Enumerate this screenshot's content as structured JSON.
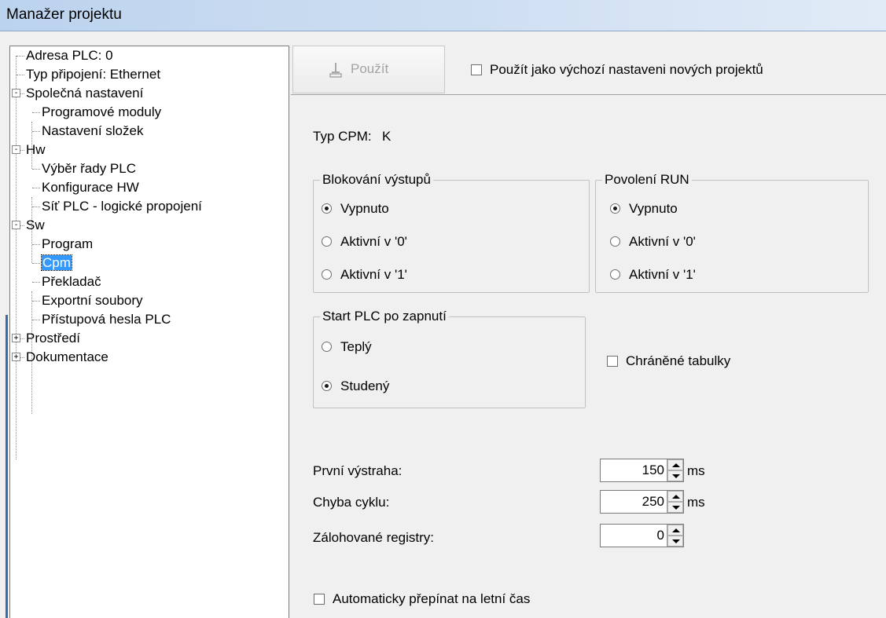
{
  "window": {
    "title": "Manažer projektu"
  },
  "tree": {
    "items": [
      {
        "label": "Adresa PLC: 0"
      },
      {
        "label": "Typ připojení: Ethernet"
      },
      {
        "label": "Společná nastavení",
        "expander": "-"
      },
      {
        "label": "Programové moduly"
      },
      {
        "label": "Nastavení složek"
      },
      {
        "label": "Hw",
        "expander": "-"
      },
      {
        "label": "Výběr řady PLC"
      },
      {
        "label": "Konfigurace HW"
      },
      {
        "label": "Síť PLC - logické propojení"
      },
      {
        "label": "Sw",
        "expander": "-"
      },
      {
        "label": "Program"
      },
      {
        "label": "Cpm",
        "selected": true
      },
      {
        "label": "Překladač"
      },
      {
        "label": "Exportní soubory"
      },
      {
        "label": "Přístupová hesla PLC"
      },
      {
        "label": "Prostředí",
        "expander": "+"
      },
      {
        "label": "Dokumentace",
        "expander": "+"
      }
    ]
  },
  "toolbar": {
    "apply_label": "Použít",
    "default_checkbox_label": "Použít jako výchozí nastaveni nových projektů",
    "default_checked": false
  },
  "cpm": {
    "type_label": "Typ CPM:",
    "type_value": "K",
    "output_block": {
      "title": "Blokování výstupů",
      "options": [
        "Vypnuto",
        "Aktivní v '0'",
        "Aktivní v '1'"
      ],
      "selected": 0
    },
    "run_enable": {
      "title": "Povolení RUN",
      "options": [
        "Vypnuto",
        "Aktivní v '0'",
        "Aktivní v '1'"
      ],
      "selected": 0
    },
    "start_plc": {
      "title": "Start PLC po zapnutí",
      "options": [
        "Teplý",
        "Studený"
      ],
      "selected": 1
    },
    "protected_tables_label": "Chráněné tabulky",
    "protected_tables_checked": false,
    "first_warning": {
      "label": "První výstraha:",
      "value": "150",
      "unit": "ms"
    },
    "cycle_error": {
      "label": "Chyba cyklu:",
      "value": "250",
      "unit": "ms"
    },
    "backup_registers": {
      "label": "Zálohované registry:",
      "value": "0"
    },
    "dst_label": "Automaticky přepínat na letní čas",
    "dst_checked": false
  },
  "colors": {
    "selection": "#3399ff",
    "titlebar": "#c4d8f0"
  },
  "icons": {
    "apply": "apply-icon",
    "expand": "expand-icon",
    "collapse": "collapse-icon"
  }
}
